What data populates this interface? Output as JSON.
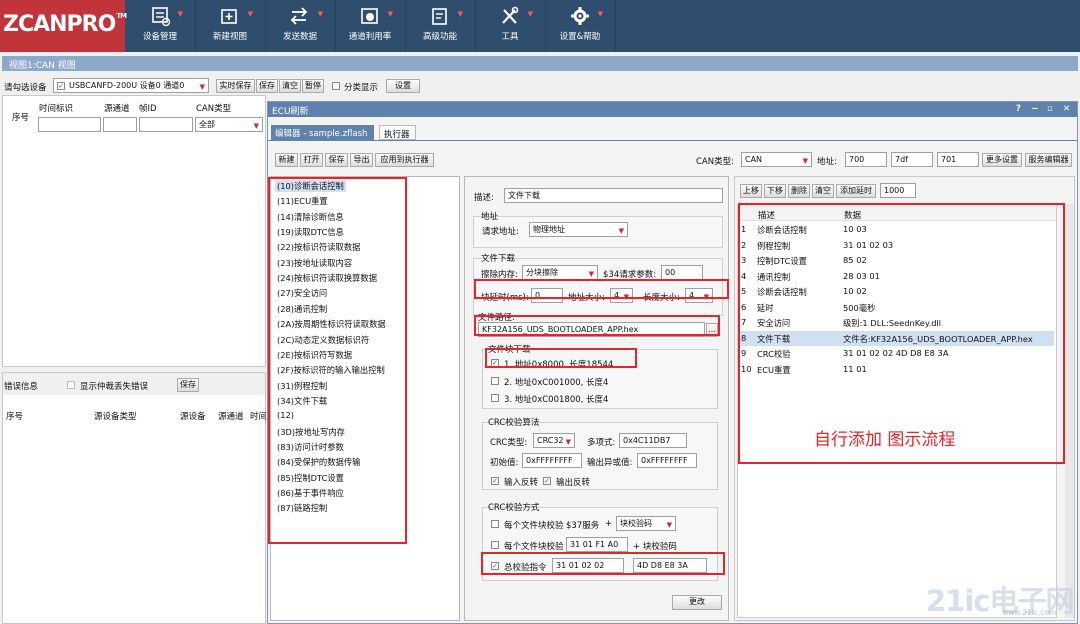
{
  "logo": {
    "text": "ZCANPRO",
    "tm": "TM"
  },
  "toolbar": [
    {
      "label": "设备管理",
      "icon": "device-settings-icon"
    },
    {
      "label": "新建视图",
      "icon": "new-view-icon"
    },
    {
      "label": "发送数据",
      "icon": "send-data-icon"
    },
    {
      "label": "通道利用率",
      "icon": "channel-usage-icon"
    },
    {
      "label": "高级功能",
      "icon": "advanced-icon"
    },
    {
      "label": "工具",
      "icon": "tools-icon"
    },
    {
      "label": "设置&帮助",
      "icon": "gear-icon"
    }
  ],
  "view_title": "视图1:CAN 视图",
  "device_bar": {
    "label": "请勾选设备",
    "device": "USBCANFD-200U 设备0 通道0",
    "realtime_save": "实时保存",
    "save": "保存",
    "clear": "清空",
    "pause": "暂停",
    "category": "分类显示",
    "settings": "设置"
  },
  "msg_table": {
    "headers": [
      "序号",
      "时间标识",
      "源通道",
      "帧ID",
      "CAN类型"
    ],
    "filter_value": "全部"
  },
  "error_panel": {
    "title": "错误信息",
    "show_lost": "显示仲裁丢失错误",
    "save": "保存",
    "headers": [
      "序号",
      "源设备类型",
      "源设备",
      "源通道",
      "时间"
    ]
  },
  "ecu": {
    "title": "ECU刷新",
    "controls": [
      "?",
      "‒",
      "▫",
      "✕"
    ],
    "tabs": [
      "编辑器 - sample.zflash",
      "执行器"
    ],
    "actions": [
      "新建",
      "打开",
      "保存",
      "导出",
      "应用到执行器"
    ],
    "can_type_label": "CAN类型:",
    "can_type": "CAN",
    "address_label": "地址:",
    "addresses": [
      "700",
      "7df",
      "701"
    ],
    "more_settings": "更多设置",
    "service_editor": "服务编辑器"
  },
  "service_list": [
    "(10)诊断会话控制",
    "(11)ECU重置",
    "(14)清除诊断信息",
    "(19)读取DTC信息",
    "(22)按标识符读取数据",
    "(23)按地址读取内容",
    "(24)按标识符读取换算数据",
    "(27)安全访问",
    "(28)通讯控制",
    "(2A)按周期性标识符读取数据",
    "(2C)动态定义数据标识符",
    "(2E)按标识符写数据",
    "(2F)按标识符的输入输出控制",
    "(31)例程控制",
    "(34)文件下载",
    "(12)",
    "(3D)按地址写内存",
    "(83)访问计时参数",
    "(84)受保护的数据传输",
    "(85)控制DTC设置",
    "(86)基于事件响应",
    "(87)链路控制"
  ],
  "detail": {
    "desc_label": "描述:",
    "desc_value": "文件下载",
    "address_group": "地址",
    "request_addr_label": "请求地址:",
    "request_addr": "物理地址",
    "download_group": "文件下载",
    "erase_label": "擦除内存:",
    "erase_value": "分块擦除",
    "s34_label": "$34请求参数:",
    "s34_value": "00",
    "delay_label": "块延时(ms):",
    "delay_value": "0",
    "addr_size_label": "地址大小:",
    "addr_size": "4",
    "len_size_label": "长度大小:",
    "len_size": "4",
    "path_label": "文件路径:",
    "path_value": "KF32A156_UDS_BOOTLOADER_APP.hex",
    "browse": "...",
    "block_group": "文件块下载",
    "blocks": [
      "1. 地址0x8000, 长度18544",
      "2. 地址0xC001000, 长度4",
      "3. 地址0xC001800, 长度4"
    ],
    "crc_group": "CRC校验算法",
    "crc_type_label": "CRC类型:",
    "crc_type": "CRC32",
    "poly_label": "多项式:",
    "poly": "0x4C11DB7",
    "init_label": "初始值:",
    "init": "0xFFFFFFFF",
    "xor_label": "输出异或值:",
    "xor": "0xFFFFFFFF",
    "in_rev": "输入反转",
    "out_rev": "输出反转",
    "crc_mode_group": "CRC校验方式",
    "mode1": "每个文件块校验",
    "mode1_svc": "$37服务",
    "plus": "+",
    "mode1_sel": "块校验码",
    "mode2": "每个文件块校验",
    "mode2_val": "31 01 F1 A0",
    "mode2_suffix": "+ 块校验码",
    "mode3": "总校验指令",
    "mode3_val": "31 01 02 02",
    "mode3_crc": "4D D8 E8 3A",
    "update": "更改"
  },
  "steps": {
    "actions": [
      "上移",
      "下移",
      "删除",
      "清空",
      "添加延时"
    ],
    "delay_value": "1000",
    "headers": [
      "描述",
      "数据"
    ],
    "rows": [
      {
        "n": "1",
        "desc": "诊断会话控制",
        "data": "10 03"
      },
      {
        "n": "2",
        "desc": "例程控制",
        "data": "31 01 02 03"
      },
      {
        "n": "3",
        "desc": "控制DTC设置",
        "data": "85 02"
      },
      {
        "n": "4",
        "desc": "通讯控制",
        "data": "28 03 01"
      },
      {
        "n": "5",
        "desc": "诊断会话控制",
        "data": "10 02"
      },
      {
        "n": "6",
        "desc": "延时",
        "data": "500毫秒"
      },
      {
        "n": "7",
        "desc": "安全访问",
        "data": "级别:1 DLL:SeednKey.dll"
      },
      {
        "n": "8",
        "desc": "文件下载",
        "data": "文件名:KF32A156_UDS_BOOTLOADER_APP.hex"
      },
      {
        "n": "9",
        "desc": "CRC校验",
        "data": "31 01 02 02 4D D8 E8 3A"
      },
      {
        "n": "10",
        "desc": "ECU重置",
        "data": "11 01"
      }
    ]
  },
  "annotation": "自行添加 图示流程",
  "watermark": "21ic电子网",
  "watermark_sub": "www.21ic.com",
  "colors": {
    "topbar": "#2f4e6e",
    "logo": "#c1343a",
    "ecu_title": "#5e82ac",
    "highlight": "#e8242a",
    "selected_row": "#cfe0f3"
  }
}
